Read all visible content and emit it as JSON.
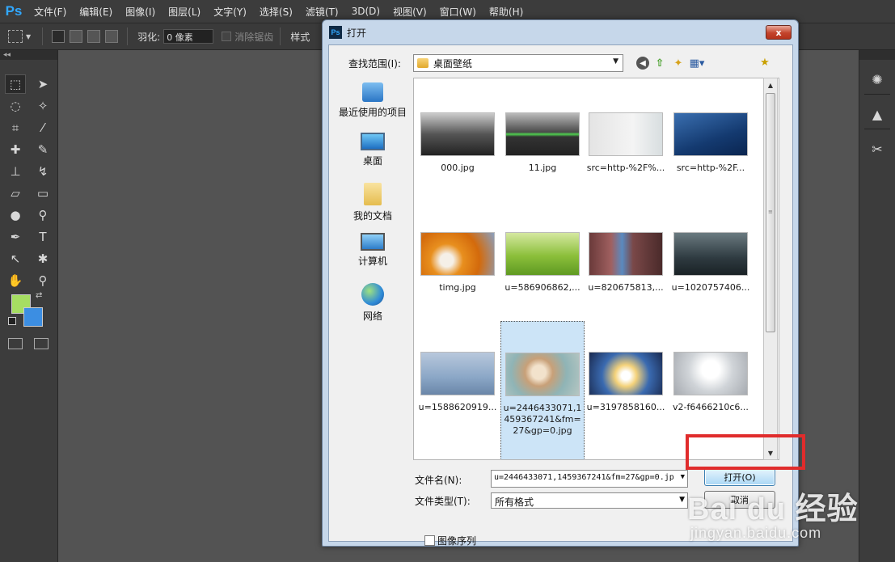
{
  "app": {
    "logo": "Ps",
    "menu": [
      "文件(F)",
      "编辑(E)",
      "图像(I)",
      "图层(L)",
      "文字(Y)",
      "选择(S)",
      "滤镜(T)",
      "3D(D)",
      "视图(V)",
      "窗口(W)",
      "帮助(H)"
    ]
  },
  "options": {
    "feather_label": "羽化:",
    "feather_value": "0 像素",
    "antialias_label": "消除锯齿",
    "style_label": "样式"
  },
  "colors": {
    "foreground": "#a6de62",
    "background": "#3c8ee2",
    "highlight": "#e02c2c"
  },
  "dialog": {
    "title": "打开",
    "close_label": "x",
    "lookin_label": "查找范围(I):",
    "lookin_value": "桌面壁纸",
    "places": [
      {
        "label": "最近使用的项目",
        "icon": "recent-icon"
      },
      {
        "label": "桌面",
        "icon": "desktop-icon"
      },
      {
        "label": "我的文档",
        "icon": "documents-icon"
      },
      {
        "label": "计算机",
        "icon": "computer-icon"
      },
      {
        "label": "网络",
        "icon": "network-icon"
      }
    ],
    "files": [
      {
        "name": "000.jpg"
      },
      {
        "name": "11.jpg"
      },
      {
        "name": "src=http-%2F%..."
      },
      {
        "name": "src=http-%2F..."
      },
      {
        "name": "timg.jpg"
      },
      {
        "name": "u=586906862,..."
      },
      {
        "name": "u=820675813,..."
      },
      {
        "name": "u=1020757406..."
      },
      {
        "name": "u=1588620919..."
      },
      {
        "name": "u=2446433071,1459367241&fm=27&gp=0.jpg"
      },
      {
        "name": "u=3197858160..."
      },
      {
        "name": "v2-f6466210c6..."
      }
    ],
    "filename_label": "文件名(N):",
    "filename_value": "u=2446433071,1459367241&fm=27&gp=0.jp",
    "filetype_label": "文件类型(T):",
    "filetype_value": "所有格式",
    "open_label": "打开(O)",
    "cancel_label": "取消",
    "image_sequence_label": "图像序列"
  },
  "watermark": {
    "brand": "Bai du 经验",
    "url": "jingyan.baidu.com"
  }
}
